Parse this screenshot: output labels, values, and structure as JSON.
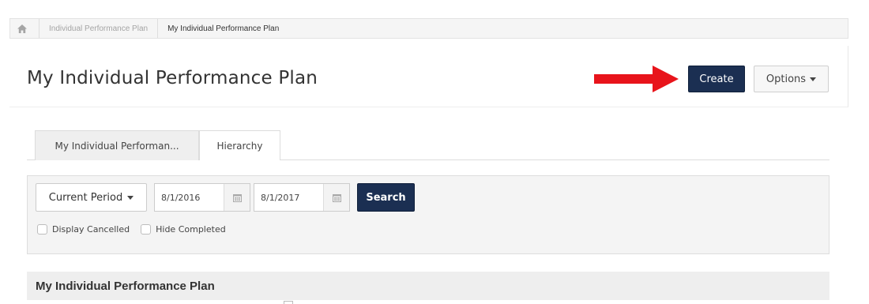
{
  "breadcrumb": {
    "home_icon": "home-icon",
    "items": [
      "Individual Performance Plan",
      "My Individual Performance Plan"
    ]
  },
  "header": {
    "title": "My Individual Performance Plan",
    "create_label": "Create",
    "options_label": "Options"
  },
  "tabs": [
    {
      "label": "My Individual Performan...",
      "active": true
    },
    {
      "label": "Hierarchy",
      "active": false
    }
  ],
  "filters": {
    "period_label": "Current Period",
    "start_date": "8/1/2016",
    "end_date": "8/1/2017",
    "search_label": "Search",
    "display_cancelled_label": "Display Cancelled",
    "hide_completed_label": "Hide Completed"
  },
  "section": {
    "title": "My Individual Performance Plan"
  },
  "colors": {
    "primary_button": "#1b2f52",
    "arrow": "#e8141b"
  }
}
